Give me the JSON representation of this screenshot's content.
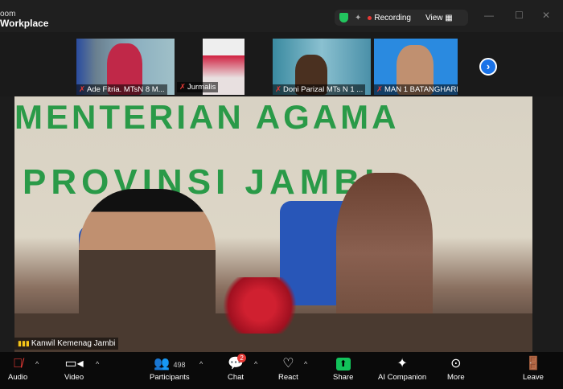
{
  "app": {
    "brand_line1": "oom",
    "brand_line2": "Workplace"
  },
  "status_bar": {
    "recording": "Recording",
    "view": "View",
    "colors": {
      "security": "#22c55e",
      "recording": "#e53935"
    }
  },
  "window_controls": {
    "minimize": "—",
    "maximize": "☐",
    "close": "✕"
  },
  "thumbnails": [
    {
      "name": "Ade Fitria. MTsN 8 M...",
      "muted": true
    },
    {
      "name": "Jurmalis",
      "muted": true
    },
    {
      "name": "Doni Parizal MTs N 1 ...",
      "muted": true
    },
    {
      "name": "MAN 1 BATANGHARI",
      "muted": true
    }
  ],
  "next_icon": "›",
  "main_video": {
    "sign_line1": "MENTERIAN AGAMA",
    "sign_line2": "PROVINSI JAMBI",
    "speaker": "Kanwil Kemenag Jambi"
  },
  "toolbar": {
    "audio": "Audio",
    "video": "Video",
    "participants": "Participants",
    "participants_count": "498",
    "chat": "Chat",
    "chat_badge": "2",
    "react": "React",
    "share": "Share",
    "ai": "AI Companion",
    "more": "More",
    "leave": "Leave"
  }
}
